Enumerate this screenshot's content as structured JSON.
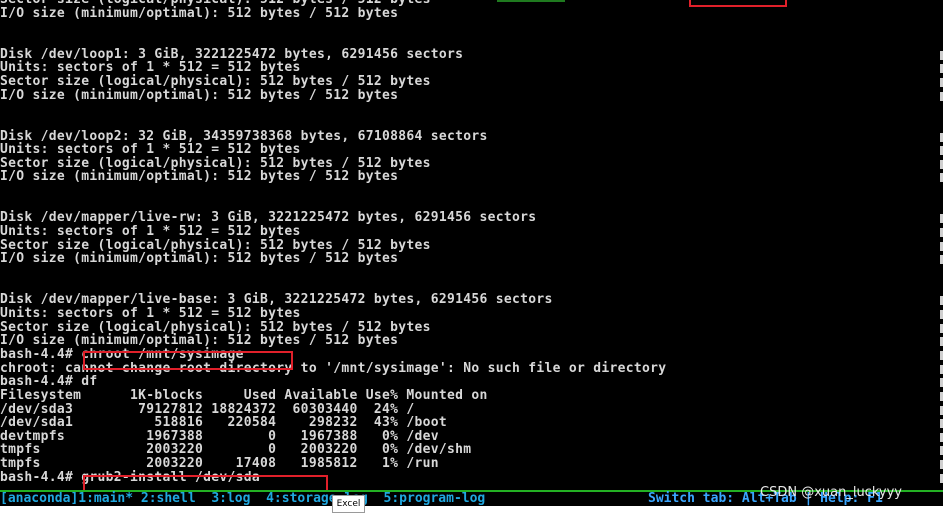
{
  "terminal": {
    "lines": [
      "Sector size (logical/physical): 512 bytes / 512 bytes",
      "I/O size (minimum/optimal): 512 bytes / 512 bytes",
      "",
      "",
      "Disk /dev/loop1: 3 GiB, 3221225472 bytes, 6291456 sectors",
      "Units: sectors of 1 * 512 = 512 bytes",
      "Sector size (logical/physical): 512 bytes / 512 bytes",
      "I/O size (minimum/optimal): 512 bytes / 512 bytes",
      "",
      "",
      "Disk /dev/loop2: 32 GiB, 34359738368 bytes, 67108864 sectors",
      "Units: sectors of 1 * 512 = 512 bytes",
      "Sector size (logical/physical): 512 bytes / 512 bytes",
      "I/O size (minimum/optimal): 512 bytes / 512 bytes",
      "",
      "",
      "Disk /dev/mapper/live-rw: 3 GiB, 3221225472 bytes, 6291456 sectors",
      "Units: sectors of 1 * 512 = 512 bytes",
      "Sector size (logical/physical): 512 bytes / 512 bytes",
      "I/O size (minimum/optimal): 512 bytes / 512 bytes",
      "",
      "",
      "Disk /dev/mapper/live-base: 3 GiB, 3221225472 bytes, 6291456 sectors",
      "Units: sectors of 1 * 512 = 512 bytes",
      "Sector size (logical/physical): 512 bytes / 512 bytes",
      "I/O size (minimum/optimal): 512 bytes / 512 bytes",
      "bash-4.4# chroot /mnt/sysimage",
      "chroot: cannot change root directory to '/mnt/sysimage': No such file or directory",
      "bash-4.4# df",
      "Filesystem      1K-blocks     Used Available Use% Mounted on",
      "/dev/sda3        79127812 18824372  60303440  24% /",
      "/dev/sda1          518816   220584    298232  43% /boot",
      "devtmpfs          1967388        0   1967388   0% /dev",
      "tmpfs             2003220        0   2003220   0% /dev/shm",
      "tmpfs             2003220    17408   1985812   1% /run",
      "bash-4.4# grub2-install /dev/sda"
    ]
  },
  "status_bar": {
    "tabs": "[anaconda]1:main* 2:shell  3:log  4:storage-log  5:program-log",
    "switch": "Switch tab: Alt+Tab | Help: F1"
  },
  "tooltip": {
    "label": "Excel"
  },
  "watermark": "CSDN @xuan_luckyyy",
  "colors": {
    "highlight_box": "#e0202a",
    "status_border": "#23b023",
    "status_text": "#20a8e0",
    "terminal_text": "#d8d8d8"
  }
}
